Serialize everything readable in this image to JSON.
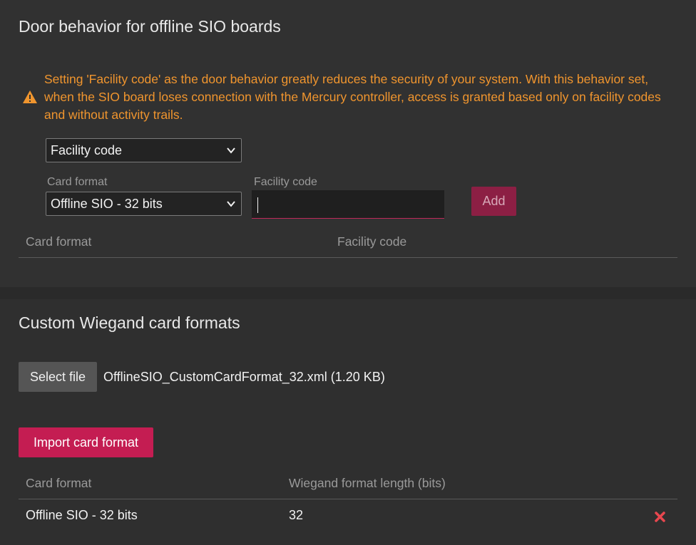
{
  "door_section": {
    "title": "Door behavior for offline SIO boards",
    "warning": "Setting 'Facility code' as the door behavior greatly reduces the security of your system. With this behavior set, when the SIO board loses connection with the Mercury controller, access is granted based only on facility codes and without activity trails.",
    "warning_icon": "warning-triangle-icon",
    "behavior_select": {
      "value": "Facility code"
    },
    "card_format_label": "Card format",
    "card_format_select": {
      "value": "Offline SIO - 32 bits"
    },
    "facility_code_label": "Facility code",
    "facility_code_input": {
      "value": ""
    },
    "add_button": "Add",
    "table": {
      "columns": [
        "Card format",
        "Facility code"
      ],
      "rows": []
    }
  },
  "wiegand_section": {
    "title": "Custom Wiegand card formats",
    "select_file_button": "Select file",
    "selected_file": "OfflineSIO_CustomCardFormat_32.xml (1.20 KB)",
    "import_button": "Import card format",
    "table": {
      "columns": [
        "Card format",
        "Wiegand format length (bits)"
      ],
      "rows": [
        {
          "card_format": "Offline SIO - 32 bits",
          "length": "32",
          "action_icon": "delete-x-icon"
        }
      ]
    }
  },
  "colors": {
    "warning": "#f0952e",
    "accent": "#c41d52",
    "accent_disabled": "#8c1f44",
    "delete": "#e8474f"
  }
}
